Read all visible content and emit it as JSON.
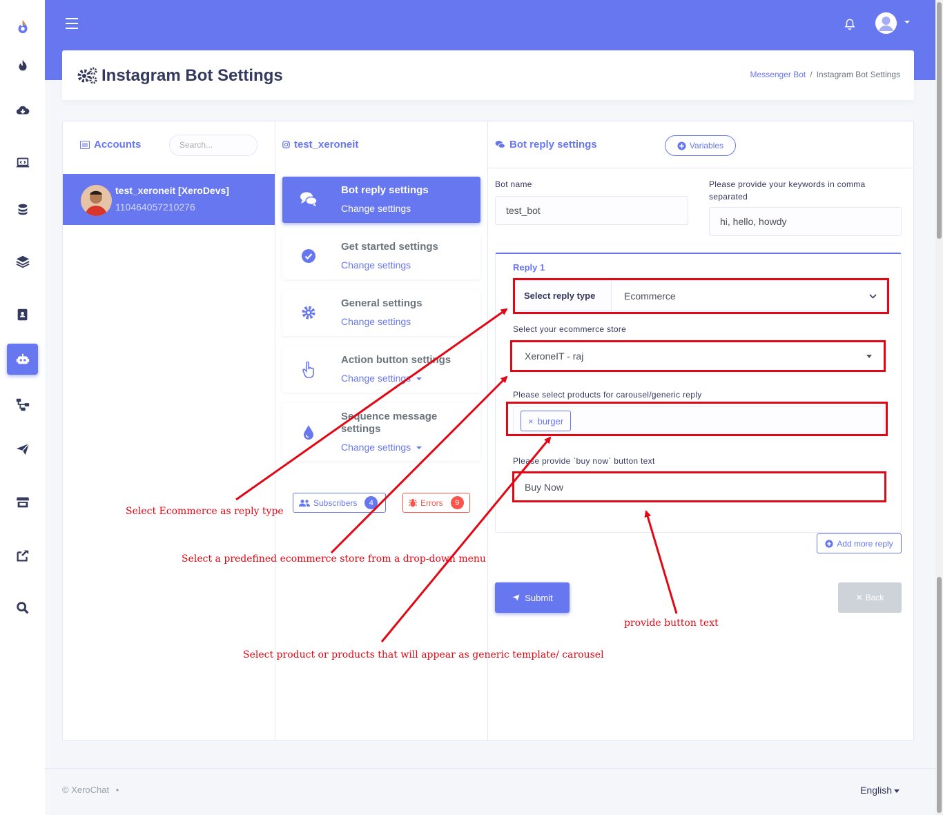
{
  "page_title": "Instagram Bot Settings",
  "breadcrumb": {
    "parent": "Messenger Bot",
    "current": "Instagram Bot Settings"
  },
  "accounts": {
    "title": "Accounts",
    "search_placeholder": "Search...",
    "items": [
      {
        "name": "test_xeroneit [XeroDevs]",
        "id": "110464057210276"
      }
    ]
  },
  "middle": {
    "title": "test_xeroneit",
    "settings": [
      {
        "title": "Bot reply settings",
        "sub": "Change settings"
      },
      {
        "title": "Get started settings",
        "sub": "Change settings"
      },
      {
        "title": "General settings",
        "sub": "Change settings"
      },
      {
        "title": "Action button settings",
        "sub": "Change settings"
      },
      {
        "title": "Sequence message settings",
        "sub": "Change settings"
      }
    ],
    "subscribers_label": "Subscribers",
    "subscribers_count": "4",
    "errors_label": "Errors",
    "errors_count": "9"
  },
  "form": {
    "title": "Bot reply settings",
    "variables_label": "Variables",
    "bot_name_label": "Bot name",
    "bot_name_value": "test_bot",
    "keywords_label": "Please provide your keywords in comma separated",
    "keywords_value": "hi, hello, howdy",
    "reply_title": "Reply 1",
    "reply_type_label": "Select reply type",
    "reply_type_value": "Ecommerce",
    "store_label": "Select your ecommerce store",
    "store_value": "XeroneIT - raj",
    "products_label": "Please select products for carousel/generic reply",
    "product_tag": "burger",
    "buy_now_label": "Please provide `buy now` button text",
    "buy_now_value": "Buy Now",
    "add_reply_label": "Add more reply",
    "submit_label": "Submit",
    "back_label": "Back"
  },
  "annotations": {
    "reply_type": "Select Ecommerce as reply type",
    "store": "Select a predefined ecommerce store from a drop-down menu",
    "products": "Select product or products that will appear as generic template/ carousel",
    "button_text": "provide button text"
  },
  "footer": {
    "copyright": "© XeroChat",
    "dot": "•",
    "language": "English"
  },
  "colors": {
    "primary": "#6777ef",
    "annotation": "#e30613",
    "danger": "#fc544b"
  }
}
